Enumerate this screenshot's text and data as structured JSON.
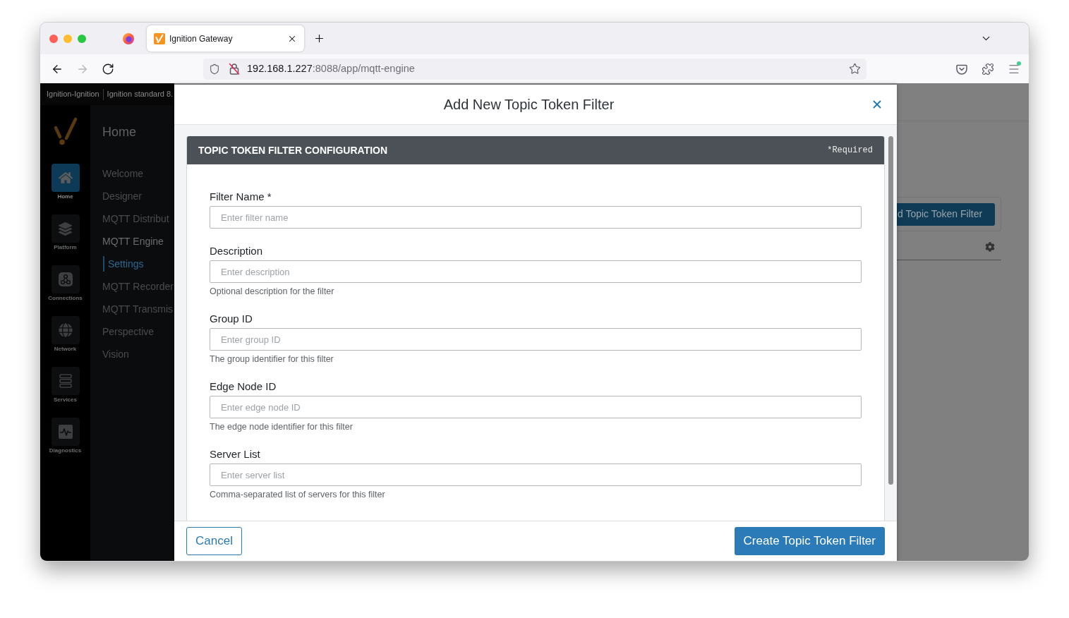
{
  "browser": {
    "tabs": [
      {
        "title": "Ignition Gateway",
        "selected": true
      }
    ],
    "nav_buttons": [
      {
        "kind": "back",
        "disabled": false
      },
      {
        "kind": "forward",
        "disabled": true
      },
      {
        "kind": "reload",
        "disabled": false
      }
    ],
    "address": {
      "host": "192.168.1.227",
      "path": ":8088/app/mqtt-engine"
    },
    "toolbar_buttons": [
      {
        "kind": "pocket",
        "badge": false
      },
      {
        "kind": "extensions",
        "badge": false
      },
      {
        "kind": "menu",
        "badge": true
      }
    ]
  },
  "gateway": {
    "header": {
      "system_name": "Ignition-Ignition",
      "edition": "Ignition standard 8."
    },
    "rail": [
      {
        "kind": "home",
        "label": "Home",
        "selected": true
      },
      {
        "kind": "platform",
        "label": "Platform",
        "selected": false
      },
      {
        "kind": "connections",
        "label": "Connections",
        "selected": false
      },
      {
        "kind": "network",
        "label": "Network",
        "selected": false
      },
      {
        "kind": "services",
        "label": "Services",
        "selected": false
      },
      {
        "kind": "diagnostics",
        "label": "Diagnostics",
        "selected": false
      }
    ],
    "nav": {
      "title": "Home",
      "items": [
        {
          "label": "Welcome",
          "selected": false,
          "expanded": false
        },
        {
          "label": "Designer",
          "selected": false,
          "expanded": false
        },
        {
          "label": "MQTT Distribut",
          "selected": false,
          "expanded": false
        },
        {
          "label": "MQTT Engine",
          "selected": false,
          "expanded": true,
          "children": [
            {
              "label": "Settings",
              "selected": true
            }
          ]
        },
        {
          "label": "MQTT Recorder",
          "selected": false,
          "expanded": false
        },
        {
          "label": "MQTT Transmis",
          "selected": false,
          "expanded": false
        },
        {
          "label": "Perspective",
          "selected": false,
          "expanded": false
        },
        {
          "label": "Vision",
          "selected": false,
          "expanded": false
        }
      ]
    },
    "page": {
      "add_button": "d Topic Token Filter"
    }
  },
  "modal": {
    "title": "Add New Topic Token Filter",
    "section": {
      "title": "TOPIC TOKEN FILTER CONFIGURATION",
      "required_note": "*Required",
      "fields": [
        {
          "label": "Filter Name *",
          "placeholder": "Enter filter name"
        },
        {
          "label": "Description",
          "placeholder": "Enter description",
          "help": "Optional description for the filter"
        },
        {
          "label": "Group ID",
          "placeholder": "Enter group ID",
          "help": "The group identifier for this filter"
        },
        {
          "label": "Edge Node ID",
          "placeholder": "Enter edge node ID",
          "help": "The edge node identifier for this filter"
        },
        {
          "label": "Server List",
          "placeholder": "Enter server list",
          "help": "Comma-separated list of servers for this filter"
        }
      ]
    },
    "buttons": [
      {
        "kind": "secondary",
        "label": "Cancel"
      },
      {
        "kind": "primary",
        "label": "Create Topic Token Filter"
      }
    ]
  }
}
